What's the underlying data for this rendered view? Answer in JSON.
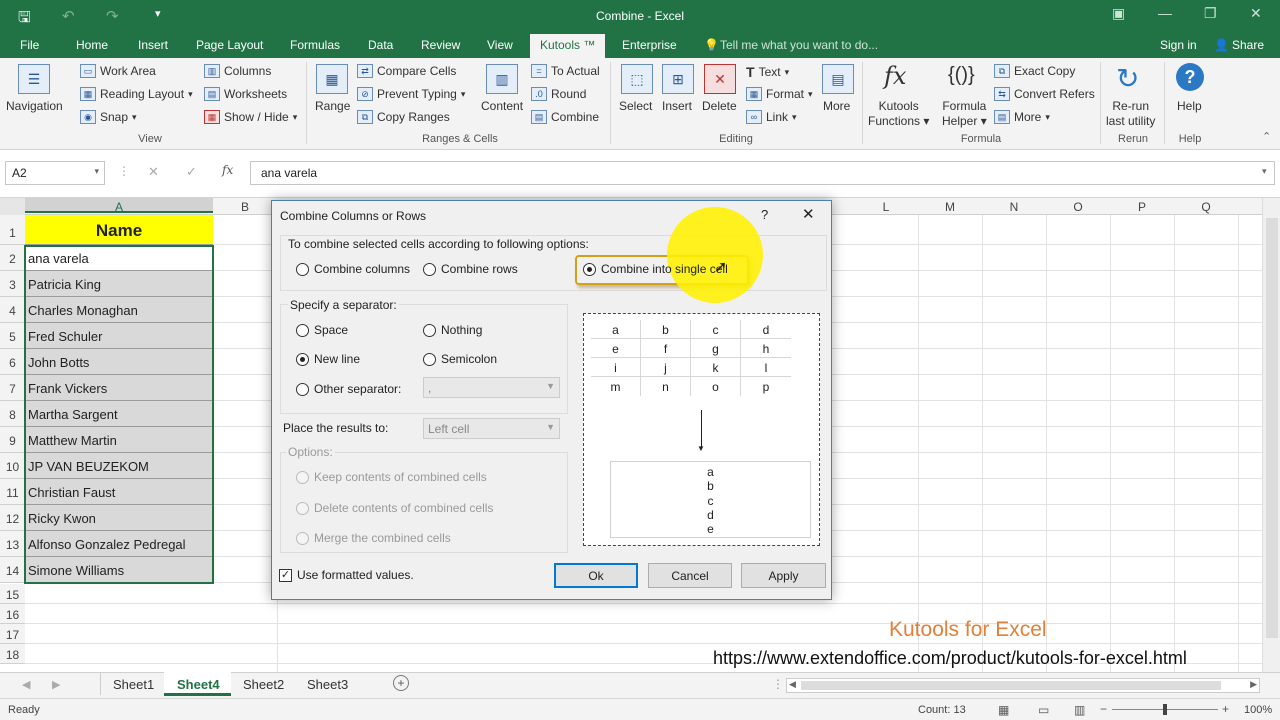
{
  "titlebar": {
    "title": "Combine - Excel"
  },
  "tabs": [
    "File",
    "Home",
    "Insert",
    "Page Layout",
    "Formulas",
    "Data",
    "Review",
    "View",
    "Kutools ™",
    "Enterprise"
  ],
  "tell_me": "Tell me what you want to do...",
  "signin": "Sign in",
  "share": "Share",
  "ribbon": {
    "navigation": "Navigation",
    "work_area": "Work Area",
    "reading_layout": "Reading Layout",
    "snap": "Snap",
    "columns": "Columns",
    "worksheets": "Worksheets",
    "show_hide": "Show / Hide",
    "view_group": "View",
    "range": "Range",
    "compare_cells": "Compare Cells",
    "prevent_typing": "Prevent Typing",
    "copy_ranges": "Copy Ranges",
    "content": "Content",
    "to_actual": "To Actual",
    "round": "Round",
    "combine": "Combine",
    "ranges_group": "Ranges & Cells",
    "select": "Select",
    "insert": "Insert",
    "delete": "Delete",
    "text": "Text",
    "format": "Format",
    "link": "Link",
    "more": "More",
    "editing_group": "Editing",
    "kutools_functions": [
      "Kutools",
      "Functions"
    ],
    "formula_helper": [
      "Formula",
      "Helper"
    ],
    "exact_copy": "Exact Copy",
    "convert_refers": "Convert Refers",
    "more2": "More",
    "formula_group": "Formula",
    "rerun": [
      "Re-run",
      "last utility"
    ],
    "rerun_group": "Rerun",
    "help": "Help",
    "help_group": "Help"
  },
  "formula_bar": {
    "name_box": "A2",
    "value": "ana varela"
  },
  "columns": [
    "A",
    "B",
    "L",
    "M",
    "N",
    "O",
    "P",
    "Q"
  ],
  "header_cell": "Name",
  "names": [
    "ana varela",
    "Patricia King",
    "Charles Monaghan",
    "Fred Schuler",
    "John Botts",
    "Frank Vickers",
    "Martha Sargent",
    "Matthew Martin",
    "JP VAN BEUZEKOM",
    "Christian Faust",
    "Ricky Kwon",
    "Alfonso Gonzalez Pedregal",
    "Simone Williams"
  ],
  "row_numbers": [
    "1",
    "2",
    "3",
    "4",
    "5",
    "6",
    "7",
    "8",
    "9",
    "10",
    "11",
    "12",
    "13",
    "14",
    "15",
    "16",
    "17",
    "18"
  ],
  "dialog": {
    "title": "Combine Columns or Rows",
    "help": "?",
    "intro": "To combine selected cells according to following options:",
    "combine_columns": "Combine columns",
    "combine_rows": "Combine rows",
    "combine_single": "Combine into single cell",
    "separator_title": "Specify a separator:",
    "space": "Space",
    "nothing": "Nothing",
    "new_line": "New line",
    "semicolon": "Semicolon",
    "other_separator": "Other separator:",
    "other_value": ",",
    "place_results": "Place the results to:",
    "place_value": "Left cell",
    "options_title": "Options:",
    "keep": "Keep contents of combined cells",
    "delete": "Delete contents of combined cells",
    "merge": "Merge the combined cells",
    "preview_grid": [
      [
        "a",
        "b",
        "c",
        "d"
      ],
      [
        "e",
        "f",
        "g",
        "h"
      ],
      [
        "i",
        "j",
        "k",
        "l"
      ],
      [
        "m",
        "n",
        "o",
        "p"
      ]
    ],
    "preview_result": [
      "a",
      "b",
      "c",
      "d",
      "e"
    ],
    "use_formatted": "Use formatted values.",
    "ok": "Ok",
    "cancel": "Cancel",
    "apply": "Apply"
  },
  "watermark": {
    "brand": "Kutools for Excel",
    "url": "https://www.extendoffice.com/product/kutools-for-excel.html"
  },
  "sheets": [
    "Sheet1",
    "Sheet4",
    "Sheet2",
    "Sheet3"
  ],
  "status": {
    "ready": "Ready",
    "count": "Count: 13",
    "zoom": "100%"
  }
}
